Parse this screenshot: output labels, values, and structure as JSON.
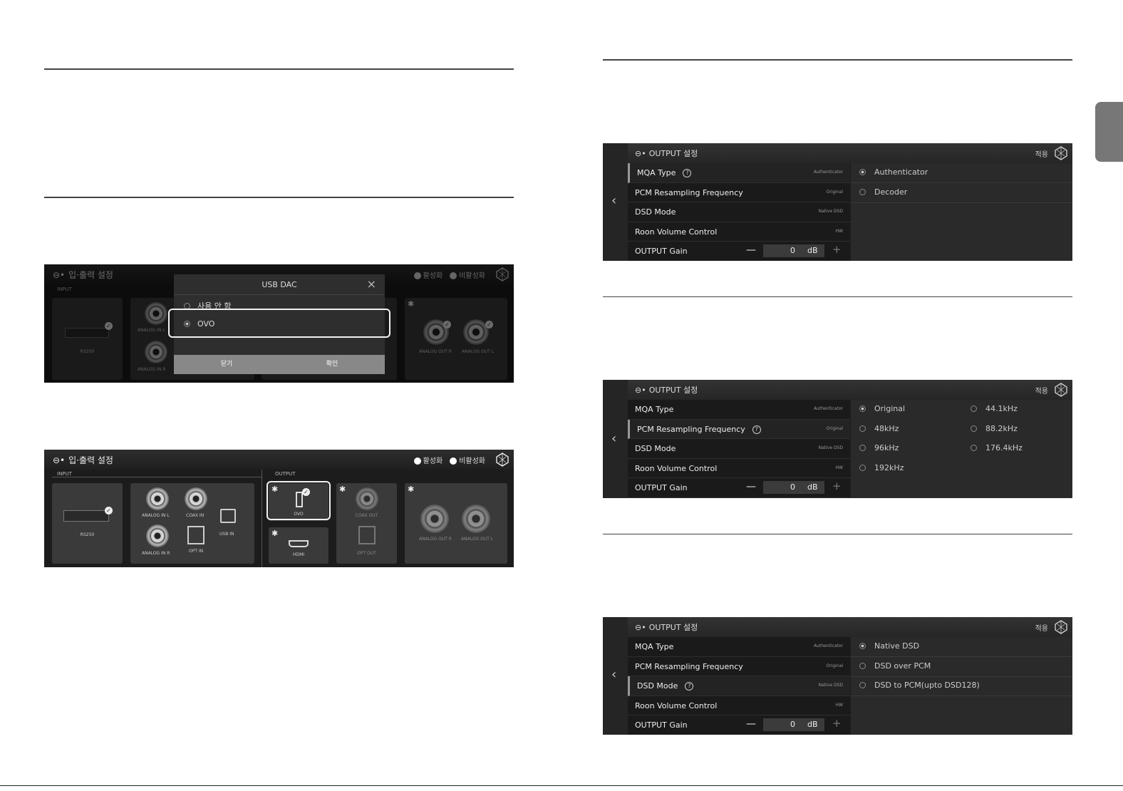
{
  "io_screen": {
    "title": "입·출력 설정",
    "legend_active": "활성화",
    "legend_inactive": "비활성화",
    "input_label": "INPUT",
    "output_label": "OUTPUT",
    "device_name": "RS250",
    "analog_in_l": "ANALOG IN L",
    "analog_in_r": "ANALOG IN R",
    "coax_in": "COAX IN",
    "opt_in": "OPT IN",
    "usb_in": "USB IN",
    "ovo": "OVO",
    "hdmi": "HDMI",
    "coax_out": "COAX OUT",
    "opt_out": "OPT OUT",
    "analog_out_r": "ANALOG OUT R",
    "analog_out_l": "ANALOG OUT L"
  },
  "usb_dac_dialog": {
    "title": "USB DAC",
    "option_disabled": "사용 안 함",
    "option_ovo": "OVO",
    "close_button": "닫기",
    "confirm_button": "확인"
  },
  "output_screen": {
    "title": "OUTPUT 설정",
    "apply": "적용",
    "menu": {
      "mqa_type": "MQA Type",
      "mqa_value": "Authenticator",
      "pcm_resampling": "PCM Resampling Frequency",
      "pcm_value": "Original",
      "dsd_mode": "DSD Mode",
      "dsd_value": "Native DSD",
      "roon_volume": "Roon Volume Control",
      "roon_value": "HW",
      "output_gain": "OUTPUT Gain",
      "gain_value": "0",
      "gain_unit": "dB"
    },
    "mqa_options": [
      "Authenticator",
      "Decoder"
    ],
    "pcm_options": [
      "Original",
      "44.1kHz",
      "48kHz",
      "88.2kHz",
      "96kHz",
      "176.4kHz",
      "192kHz"
    ],
    "dsd_options": [
      "Native DSD",
      "DSD over PCM",
      "DSD to PCM(upto DSD128)"
    ]
  },
  "colors": {
    "panel_bg": "#1c1c1c",
    "accent": "#f2f2f2"
  }
}
